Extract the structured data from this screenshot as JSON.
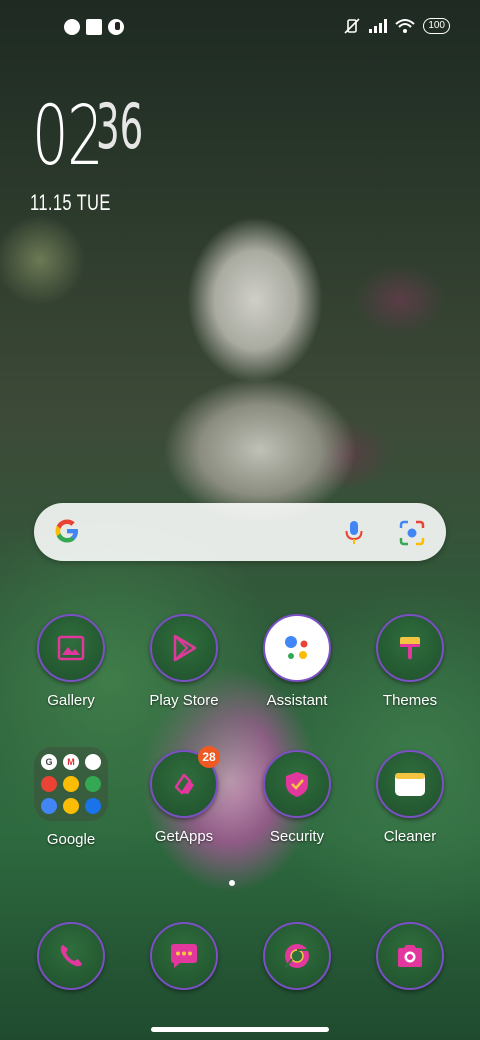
{
  "status_bar": {
    "battery": "100",
    "left_icons": [
      "notification-icon",
      "square-notification-icon",
      "message-notification-icon"
    ],
    "right_icons": [
      "vibrate-off-icon",
      "signal-icon",
      "wifi-icon",
      "battery-icon"
    ]
  },
  "clock": {
    "hours": "02",
    "minutes": "36",
    "date": "11.15 TUE"
  },
  "search": {
    "icons": [
      "google-g-icon",
      "mic-icon",
      "lens-camera-icon"
    ]
  },
  "apps_row1": [
    {
      "label": "Gallery",
      "icon": "gallery-icon"
    },
    {
      "label": "Play Store",
      "icon": "play-store-icon"
    },
    {
      "label": "Assistant",
      "icon": "assistant-icon"
    },
    {
      "label": "Themes",
      "icon": "themes-brush-icon"
    }
  ],
  "apps_row2": [
    {
      "label": "Google",
      "icon": "folder-icon"
    },
    {
      "label": "GetApps",
      "icon": "getapps-icon",
      "badge": "28"
    },
    {
      "label": "Security",
      "icon": "security-shield-icon"
    },
    {
      "label": "Cleaner",
      "icon": "cleaner-icon"
    }
  ],
  "folder_items": [
    "G",
    "M",
    "",
    "",
    "",
    "",
    "",
    "",
    ""
  ],
  "dock": [
    {
      "icon": "phone-icon"
    },
    {
      "icon": "messages-icon"
    },
    {
      "icon": "chrome-icon"
    },
    {
      "icon": "camera-icon"
    }
  ],
  "colors": {
    "accent": "#e2389e",
    "ring": "#7b4fc6",
    "badge": "#f05a22"
  }
}
